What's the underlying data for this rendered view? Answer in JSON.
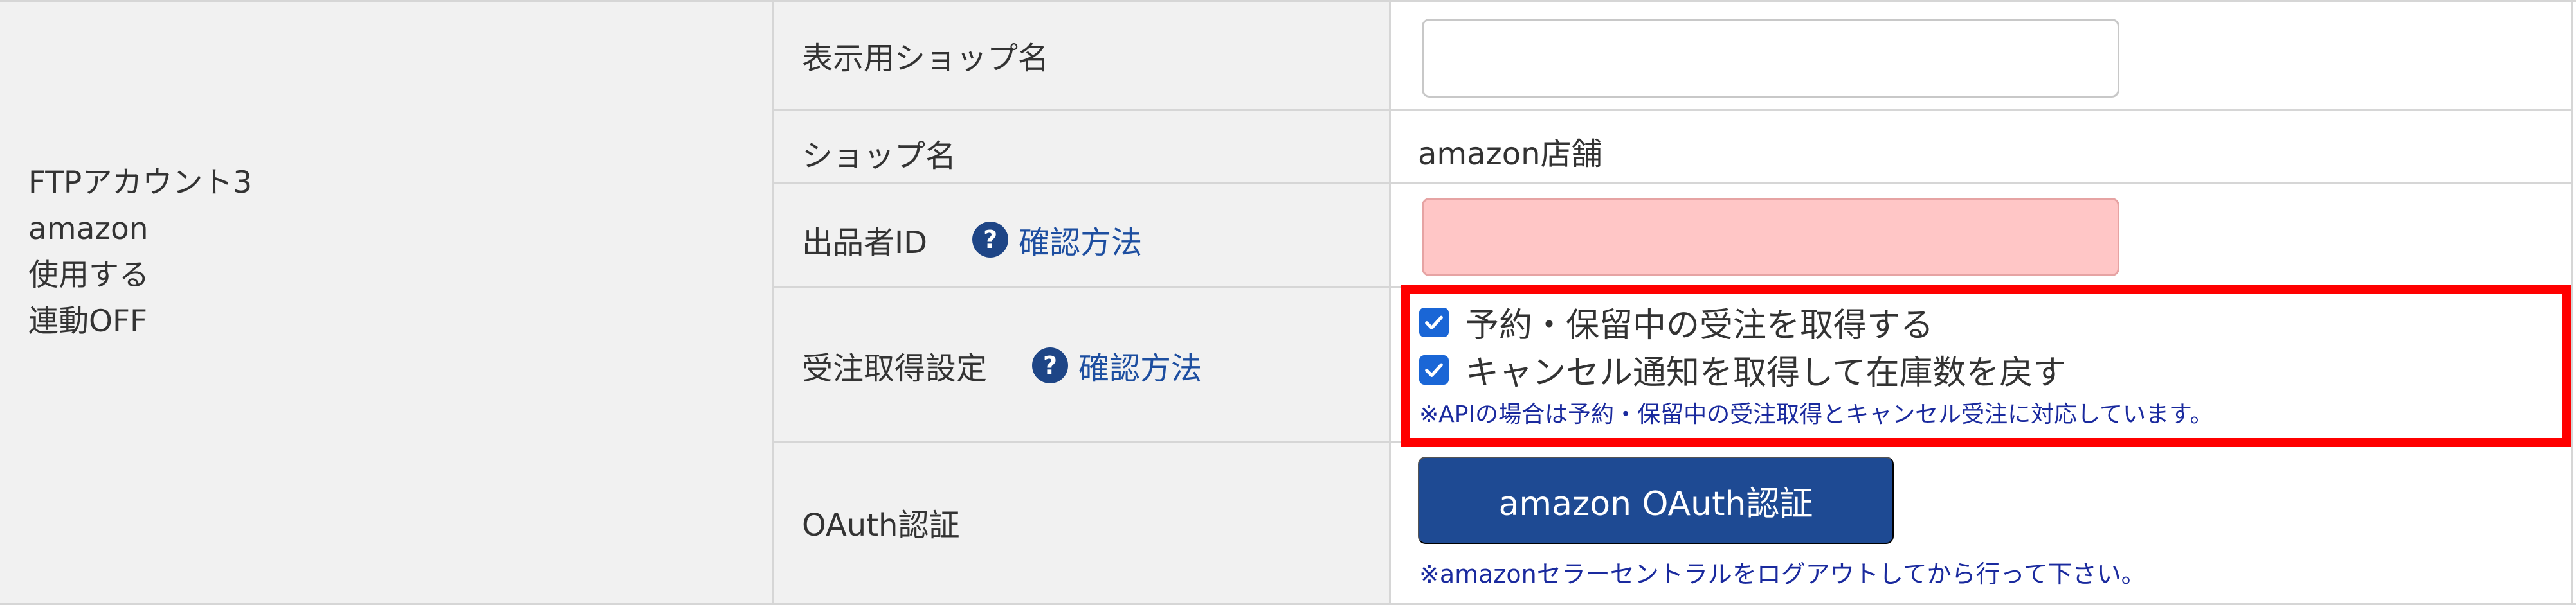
{
  "account": {
    "lines": [
      "FTPアカウント3",
      "amazon",
      "使用する",
      "連動OFF"
    ]
  },
  "rows": {
    "display_shop_name": {
      "label": "表示用ショップ名",
      "value": ""
    },
    "shop_name": {
      "label": "ショップ名",
      "value": "amazon店舗"
    },
    "seller_id": {
      "label": "出品者ID",
      "help_icon": "?",
      "help_link": "確認方法",
      "value": ""
    },
    "order_settings": {
      "label": "受注取得設定",
      "help_icon": "?",
      "help_link": "確認方法",
      "options": [
        {
          "label": "予約・保留中の受注を取得する",
          "checked": true
        },
        {
          "label": "キャンセル通知を取得して在庫数を戻す",
          "checked": true
        }
      ],
      "note": "※APIの場合は予約・保留中の受注取得とキャンセル受注に対応しています。"
    },
    "oauth": {
      "label": "OAuth認証",
      "button_label": "amazon OAuth認証",
      "note": "※amazonセラーセントラルをログアウトしてから行って下さい。"
    }
  },
  "colors": {
    "label_bg": "#f1f1f1",
    "border": "#d6d6d6",
    "error_bg": "#ffc6c6",
    "link": "#1d4ea0",
    "button": "#1e4a93",
    "checkbox": "#1a66d6",
    "note": "#1a2a9e",
    "highlight": "#ff0000"
  },
  "icons": {
    "help": "question-circle-icon",
    "check": "checkmark-icon"
  }
}
